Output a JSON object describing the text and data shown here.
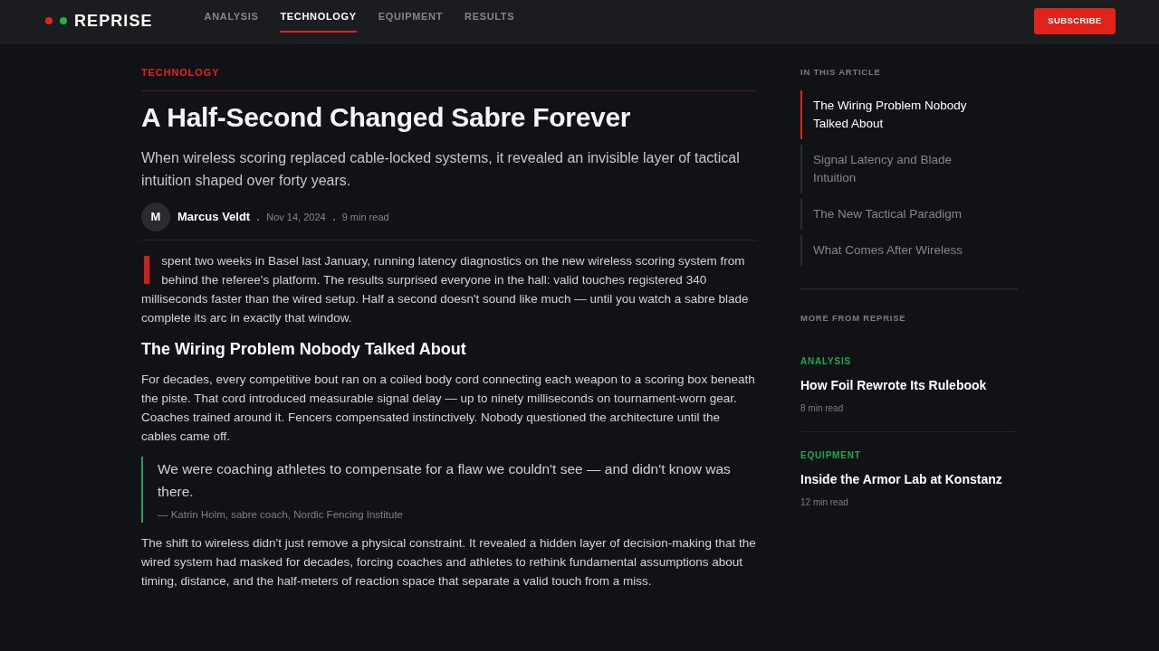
{
  "header": {
    "brand": "REPRISE",
    "nav": [
      {
        "label": "ANALYSIS",
        "selected": false
      },
      {
        "label": "TECHNOLOGY",
        "selected": true
      },
      {
        "label": "EQUIPMENT",
        "selected": false
      },
      {
        "label": "RESULTS",
        "selected": false
      }
    ],
    "subscribe_button": "SUBSCRIBE"
  },
  "article": {
    "category": "TECHNOLOGY",
    "title": "A Half-Second Changed Sabre Forever",
    "subtitle": "When wireless scoring replaced cable-locked systems, it revealed an invisible layer of tactical intuition shaped over forty years.",
    "author": {
      "initial": "M",
      "name": "Marcus Veldt"
    },
    "date": "Nov 14, 2024",
    "read_time": "9 min read",
    "body": [
      {
        "kind": "paragraph",
        "dropcap": "I",
        "text": "spent two weeks in Basel last January, running latency diagnostics on the new wireless scoring system from behind the referee's platform. The results surprised everyone in the hall: valid touches registered 340 milliseconds faster than the wired setup. Half a second doesn't sound like much — until you watch a sabre blade complete its arc in exactly that window."
      },
      {
        "kind": "heading",
        "text": "The Wiring Problem Nobody Talked About"
      },
      {
        "kind": "paragraph",
        "text": "For decades, every competitive bout ran on a coiled body cord connecting each weapon to a scoring box beneath the piste. That cord introduced measurable signal delay — up to ninety milliseconds on tournament-worn gear. Coaches trained around it. Fencers compensated instinctively. Nobody questioned the architecture until the cables came off."
      },
      {
        "kind": "quote",
        "text": "We were coaching athletes to compensate for a flaw we couldn't see — and didn't know was there.",
        "cite": "— Katrin Holm, sabre coach, Nordic Fencing Institute"
      },
      {
        "kind": "paragraph",
        "text": "The shift to wireless didn't just remove a physical constraint. It revealed a hidden layer of decision-making that the wired system had masked for decades, forcing coaches and athletes to rethink fundamental assumptions about timing, distance, and the half-meters of reaction space that separate a valid touch from a miss."
      }
    ]
  },
  "sidebar": {
    "toc": {
      "title": "IN THIS ARTICLE",
      "items": [
        {
          "label": "The Wiring Problem Nobody Talked About",
          "selected": true
        },
        {
          "label": "Signal Latency and Blade Intuition",
          "selected": false
        },
        {
          "label": "The New Tactical Paradigm",
          "selected": false
        },
        {
          "label": "What Comes After Wireless",
          "selected": false
        }
      ]
    },
    "more": {
      "title": "MORE FROM REPRISE",
      "items": [
        {
          "category": "ANALYSIS",
          "title": "How Foil Rewrote Its Rulebook",
          "read_time": "8 min read"
        },
        {
          "category": "EQUIPMENT",
          "title": "Inside the Armor Lab at Konstanz",
          "read_time": "12 min read"
        }
      ]
    }
  }
}
